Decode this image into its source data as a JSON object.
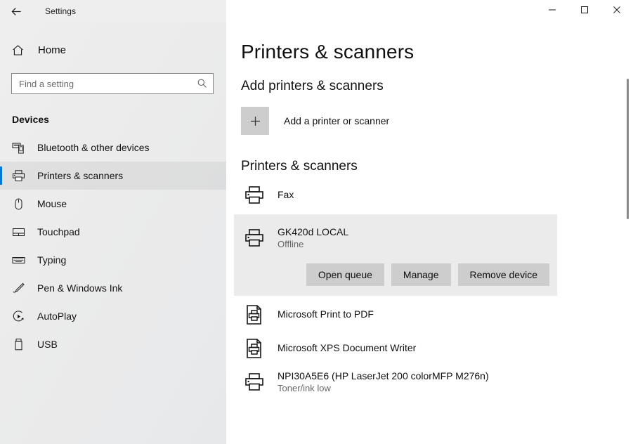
{
  "window": {
    "app_title": "Settings",
    "back_icon": "back-arrow-icon",
    "minimize_label": "—",
    "maximize_label": "□",
    "close_label": "✕"
  },
  "sidebar": {
    "home_label": "Home",
    "home_icon": "home-icon",
    "search": {
      "placeholder": "Find a setting",
      "value": "",
      "icon": "search-icon"
    },
    "section_title": "Devices",
    "items": [
      {
        "label": "Bluetooth & other devices",
        "icon": "bluetooth-devices-icon",
        "selected": false
      },
      {
        "label": "Printers & scanners",
        "icon": "printer-icon",
        "selected": true
      },
      {
        "label": "Mouse",
        "icon": "mouse-icon",
        "selected": false
      },
      {
        "label": "Touchpad",
        "icon": "touchpad-icon",
        "selected": false
      },
      {
        "label": "Typing",
        "icon": "keyboard-icon",
        "selected": false
      },
      {
        "label": "Pen & Windows Ink",
        "icon": "pen-icon",
        "selected": false
      },
      {
        "label": "AutoPlay",
        "icon": "autoplay-icon",
        "selected": false
      },
      {
        "label": "USB",
        "icon": "usb-icon",
        "selected": false
      }
    ]
  },
  "main": {
    "page_title": "Printers & scanners",
    "add_section": {
      "heading": "Add printers & scanners",
      "button_label": "Add a printer or scanner",
      "plus_icon": "plus-icon"
    },
    "list_section": {
      "heading": "Printers & scanners",
      "printers": [
        {
          "name": "Fax",
          "status": "",
          "icon": "printer-icon",
          "selected": false
        },
        {
          "name": "GK420d LOCAL",
          "status": "Offline",
          "icon": "printer-icon",
          "selected": true,
          "actions": [
            {
              "label": "Open queue",
              "name": "open-queue-button"
            },
            {
              "label": "Manage",
              "name": "manage-button"
            },
            {
              "label": "Remove device",
              "name": "remove-device-button"
            }
          ]
        },
        {
          "name": "Microsoft Print to PDF",
          "status": "",
          "icon": "document-printer-icon",
          "selected": false
        },
        {
          "name": "Microsoft XPS Document Writer",
          "status": "",
          "icon": "document-printer-icon",
          "selected": false
        },
        {
          "name": "NPI30A5E6 (HP LaserJet 200 colorMFP M276n)",
          "status": "Toner/ink low",
          "icon": "printer-icon",
          "selected": false
        }
      ]
    }
  },
  "colors": {
    "accent": "#0078d7",
    "sidebar_bg": "#eeeeee",
    "card_bg": "#ebebeb",
    "button_bg": "#cdcdcd",
    "status_text": "#666666"
  }
}
